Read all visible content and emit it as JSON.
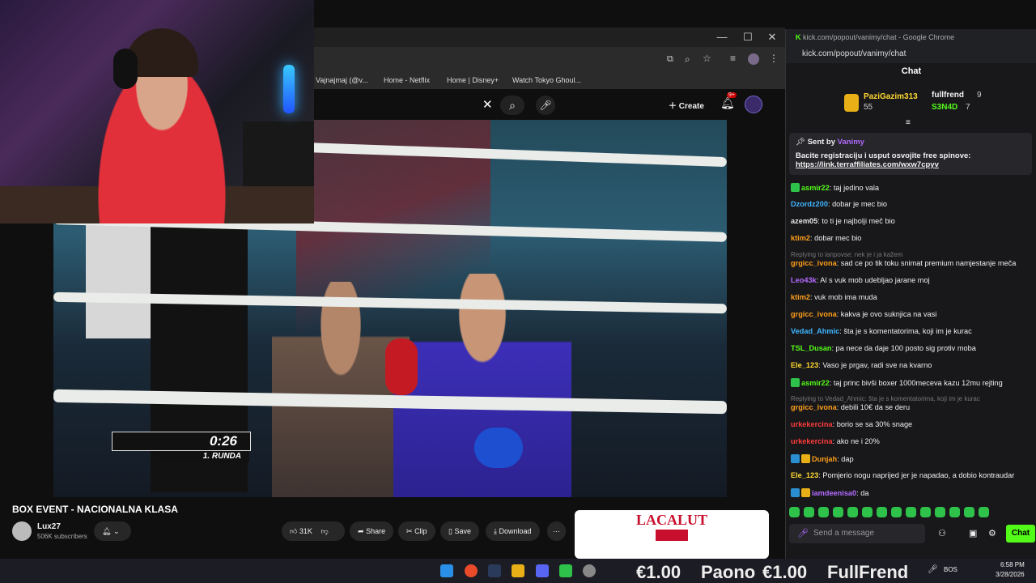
{
  "youtube": {
    "bookmarks": [
      "Vajnajmaj (@v...",
      "Home - Netflix",
      "Home | Disney+",
      "Watch Tokyo Ghoul..."
    ],
    "create_label": "Create",
    "notif_count": "9+",
    "video": {
      "timer": "0:26",
      "round": "1. RUNDA",
      "title": "BOX EVENT - NACIONALNA KLASA"
    },
    "channel": {
      "name": "Lux27",
      "subscribers": "506K subscribers"
    },
    "actions": {
      "likes": "31K",
      "share": "Share",
      "clip": "Clip",
      "save": "Save",
      "download": "Download"
    },
    "ad_brand": "LACALUT"
  },
  "chat": {
    "window_title": "kick.com/popout/vanimy/chat - Google Chrome",
    "url": "kick.com/popout/vanimy/chat",
    "header": "Chat",
    "leaders": [
      {
        "name": "PaziGazim313",
        "count": "55"
      },
      {
        "name": "fullfrend",
        "count": "9"
      },
      {
        "name": "S3N4D",
        "count": "7"
      }
    ],
    "pinned": {
      "sent_by_label": "Sent by",
      "author": "Vanimy",
      "text": "Bacite registraciju i usput osvojite free spinove:",
      "link": "https://link.terraffiliates.com/wxw7cpyv"
    },
    "messages": [
      {
        "user": "asmir22",
        "text": "taj jedino vala",
        "color": "#53fc18"
      },
      {
        "user": "Dzordz200",
        "text": "dobar je mec bio",
        "color": "#3fb6ff"
      },
      {
        "user": "azem05",
        "text": "to ti je najbolji meč bio",
        "color": "#e5e5e5"
      },
      {
        "user": "ktim2",
        "text": "dobar mec bio",
        "color": "#ff9f1a"
      },
      {
        "reply": "Replying to lanpovse: nek je i ja kažem"
      },
      {
        "user": "grgicc_ivona",
        "text": "sad ce po tik toku snimat premium namjestanje meča",
        "color": "#ff9f1a"
      },
      {
        "user": "Leo43k",
        "text": "Al s vuk mob udebljao jarane moj",
        "color": "#b26bff"
      },
      {
        "user": "ktim2",
        "text": "vuk mob ima muda",
        "color": "#ff9f1a"
      },
      {
        "user": "grgicc_ivona",
        "text": "kakva je ovo suknjica na vasi",
        "color": "#ff9f1a"
      },
      {
        "user": "Vedad_Ahmic",
        "text": "šta je s komentatorima, koji im je kurac",
        "color": "#3fb6ff"
      },
      {
        "user": "TSL_Dusan",
        "text": "pa nece da daje 100 posto sig protiv moba",
        "color": "#53fc18"
      },
      {
        "user": "Ele_123",
        "text": "Vaso je prgav, radi sve na kvarno",
        "color": "#ffd92f"
      },
      {
        "user": "asmir22",
        "text": "taj princ bivši boxer 1000meceva kazu 12mu rejting",
        "color": "#53fc18"
      },
      {
        "reply": "Replying to Vedad_Ahmic: šta je s komentatorima, koji im je kurac"
      },
      {
        "user": "grgicc_ivona",
        "text": "debili 10€ da se deru",
        "color": "#ff9f1a"
      },
      {
        "user": "urkekercina",
        "text": "borio se sa 30% snage",
        "color": "#ff3b3b"
      },
      {
        "user": "urkekercina",
        "text": "ako ne i 20%",
        "color": "#ff3b3b"
      },
      {
        "user": "Dunjah",
        "text": "dap",
        "color": "#ff9f1a"
      },
      {
        "user": "Ele_123",
        "text": "Pomjerio nogu naprijed jer je napadao, a dobio kontraudar",
        "color": "#ffd92f"
      },
      {
        "user": "iamdeenisa0",
        "text": "da",
        "color": "#b26bff"
      }
    ],
    "input_placeholder": "Send a message",
    "chat_button": "Chat"
  },
  "taskbar": {
    "ticker": [
      "€1.00",
      "Paono",
      "€1.00",
      "FullFrend"
    ],
    "lang": "BOS",
    "time": "6:58 PM",
    "date": "3/28/2026"
  }
}
